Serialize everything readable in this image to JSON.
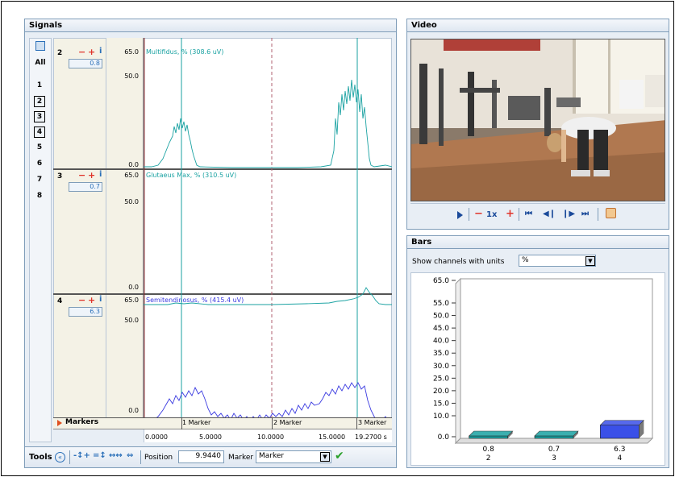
{
  "signals": {
    "title": "Signals",
    "sidebar": {
      "all_label": "All",
      "channels": [
        "1",
        "2",
        "3",
        "4",
        "5",
        "6",
        "7",
        "8"
      ]
    },
    "channels": [
      {
        "num": "2",
        "value": "0.8",
        "label": "Multifidus, % (308.6 uV)",
        "ymax": "65.0",
        "ymid": "50.0",
        "ymin": "0.0",
        "color": "#1aa2a2"
      },
      {
        "num": "3",
        "value": "0.7",
        "label": "Glutaeus Max, % (310.5 uV)",
        "ymax": "65.0",
        "ymid": "50.0",
        "ymin": "0.0",
        "color": "#1aa2a2"
      },
      {
        "num": "4",
        "value": "6.3",
        "label": "Semitendinosus, % (415.4 uV)",
        "ymax": "65.0",
        "ymid": "50.0",
        "ymin": "0.0",
        "color": "#3a3ae0"
      }
    ],
    "markers_label": "Markers",
    "markers": [
      "1 Marker",
      "2 Marker",
      "3 Marker"
    ],
    "time_ticks": [
      "0.0000",
      "5.0000",
      "10.0000",
      "15.0000",
      "19.2700 s"
    ],
    "toolbar": {
      "tools_label": "Tools",
      "position_label": "Position",
      "position_value": "9.9440",
      "marker_label": "Marker",
      "marker_value": "Marker"
    }
  },
  "video": {
    "title": "Video",
    "speed_label": "1x"
  },
  "bars": {
    "title": "Bars",
    "units_label": "Show channels with units",
    "units_value": "%",
    "y_ticks": [
      "65.0",
      "55.0",
      "50.0",
      "45.0",
      "40.0",
      "35.0",
      "30.0",
      "25.0",
      "20.0",
      "15.0",
      "10.0",
      "0.0"
    ],
    "bars": [
      {
        "value": "0.8",
        "channel": "2",
        "color": "#1aa2a2"
      },
      {
        "value": "0.7",
        "channel": "3",
        "color": "#1aa2a2"
      },
      {
        "value": "6.3",
        "channel": "4",
        "color": "#3a50e8"
      }
    ]
  }
}
